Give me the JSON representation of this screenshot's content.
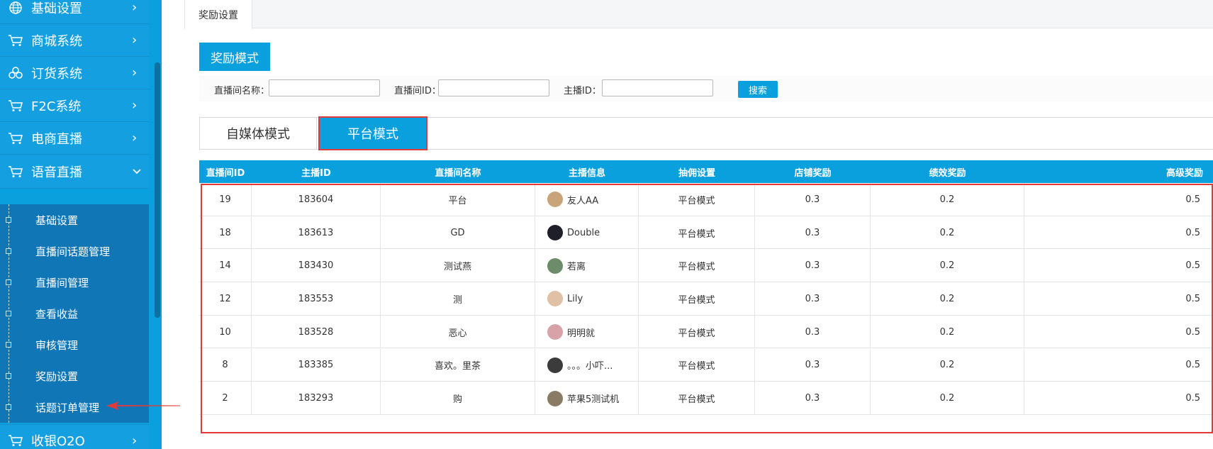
{
  "sidebar": {
    "menu": [
      {
        "label": "基础设置",
        "icon": "globe-icon",
        "arrow": "›"
      },
      {
        "label": "商城系统",
        "icon": "cart-icon",
        "arrow": "›"
      },
      {
        "label": "订货系统",
        "icon": "cubes-icon",
        "arrow": "›"
      },
      {
        "label": "F2C系统",
        "icon": "cart-icon",
        "arrow": "›"
      },
      {
        "label": "电商直播",
        "icon": "cart-icon",
        "arrow": "›"
      },
      {
        "label": "语音直播",
        "icon": "cart-icon",
        "arrow": "⌄"
      },
      {
        "label": "收银O2O",
        "icon": "cart-icon",
        "arrow": "›"
      }
    ],
    "submenu": [
      {
        "label": "基础设置"
      },
      {
        "label": "直播间话题管理"
      },
      {
        "label": "直播间管理"
      },
      {
        "label": "查看收益"
      },
      {
        "label": "审核管理"
      },
      {
        "label": "奖励设置"
      },
      {
        "label": "话题订单管理"
      }
    ]
  },
  "tabs": {
    "active": "奖励设置"
  },
  "page": {
    "mode_button": "奖励模式",
    "filter": {
      "room_name_label": "直播间名称：",
      "room_name_value": "",
      "room_id_label": "直播间ID：",
      "room_id_value": "",
      "anchor_id_label": "主播ID：",
      "anchor_id_value": "",
      "search_label": "搜索"
    },
    "mode_tabs": {
      "self_media": "自媒体模式",
      "platform": "平台模式"
    }
  },
  "table": {
    "headers": [
      "直播间ID",
      "主播ID",
      "直播间名称",
      "主播信息",
      "抽佣设置",
      "店铺奖励",
      "绩效奖励",
      "高级奖励"
    ],
    "rows": [
      {
        "room_id": "19",
        "anchor_id": "183604",
        "room_name": "平台",
        "anchor": "友人AA",
        "avatar_color": "#c9a37a",
        "commission": "平台模式",
        "shop_reward": "0.3",
        "perf_reward": "0.2",
        "senior_reward": "0.5"
      },
      {
        "room_id": "18",
        "anchor_id": "183613",
        "room_name": "GD",
        "anchor": "Double",
        "avatar_color": "#1f1f2a",
        "commission": "平台模式",
        "shop_reward": "0.3",
        "perf_reward": "0.2",
        "senior_reward": "0.5"
      },
      {
        "room_id": "14",
        "anchor_id": "183430",
        "room_name": "测试燕",
        "anchor": "若离",
        "avatar_color": "#6d8c6a",
        "commission": "平台模式",
        "shop_reward": "0.3",
        "perf_reward": "0.2",
        "senior_reward": "0.5"
      },
      {
        "room_id": "12",
        "anchor_id": "183553",
        "room_name": "测",
        "anchor": "Lily",
        "avatar_color": "#e0c1a6",
        "commission": "平台模式",
        "shop_reward": "0.3",
        "perf_reward": "0.2",
        "senior_reward": "0.5"
      },
      {
        "room_id": "10",
        "anchor_id": "183528",
        "room_name": "恶心",
        "anchor": "明明就",
        "avatar_color": "#d7a3a8",
        "commission": "平台模式",
        "shop_reward": "0.3",
        "perf_reward": "0.2",
        "senior_reward": "0.5"
      },
      {
        "room_id": "8",
        "anchor_id": "183385",
        "room_name": "喜欢。里茶",
        "anchor": "。。。小吓...",
        "avatar_color": "#3b3b3b",
        "commission": "平台模式",
        "shop_reward": "0.3",
        "perf_reward": "0.2",
        "senior_reward": "0.5"
      },
      {
        "room_id": "2",
        "anchor_id": "183293",
        "room_name": "购",
        "anchor": "苹果5测试机",
        "avatar_color": "#8a7b64",
        "commission": "平台模式",
        "shop_reward": "0.3",
        "perf_reward": "0.2",
        "senior_reward": "0.5"
      }
    ]
  },
  "colors": {
    "accent": "#0aa0de",
    "sidebar_sub": "#1176b6",
    "highlight": "#e03a3a"
  }
}
